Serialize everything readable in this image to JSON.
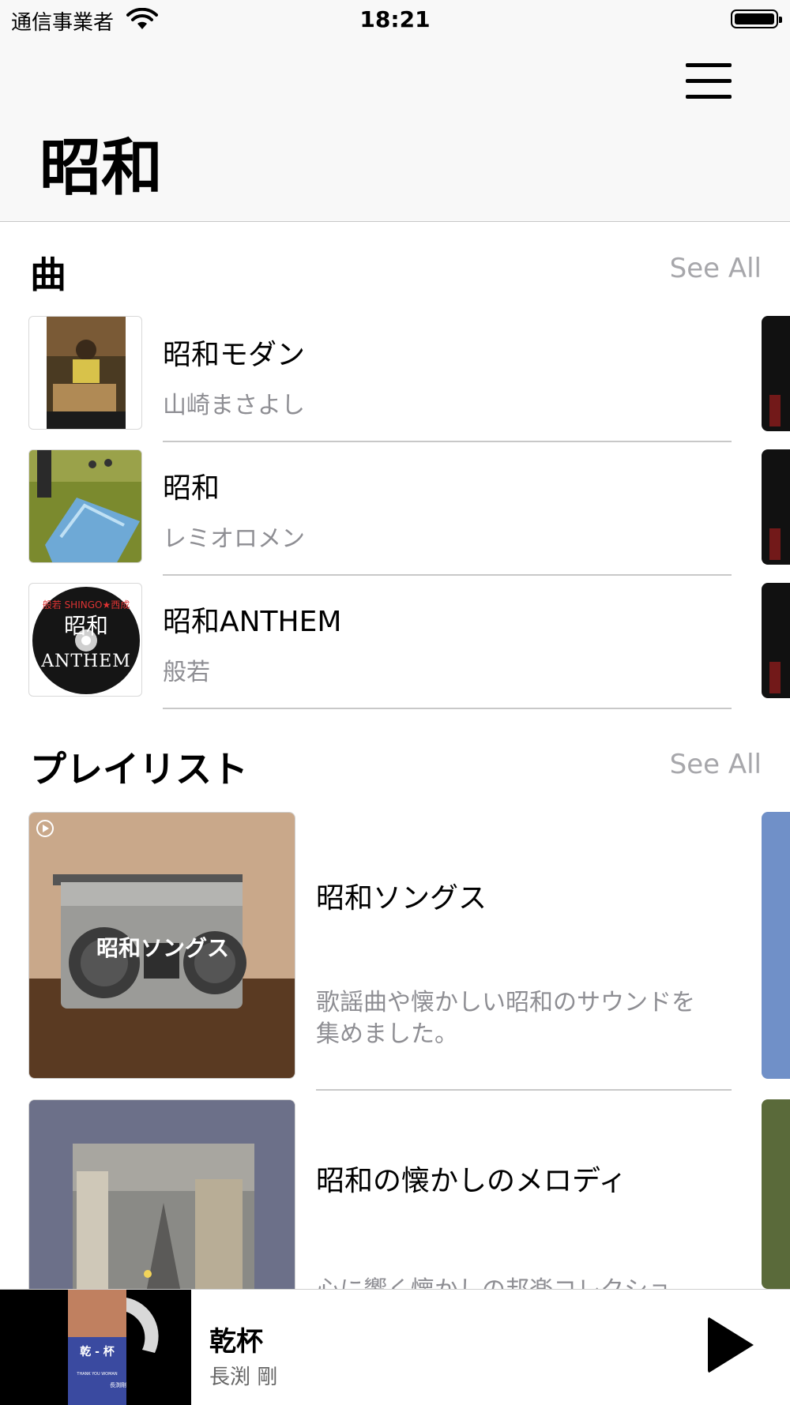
{
  "status_bar": {
    "carrier": "通信事業者",
    "time": "18:21"
  },
  "nav": {
    "title": "昭和"
  },
  "songs_section": {
    "title": "曲",
    "see_all": "See All",
    "items": [
      {
        "title": "昭和モダン",
        "artist": "山崎まさよし"
      },
      {
        "title": "昭和",
        "artist": "レミオロメン"
      },
      {
        "title": "昭和ANTHEM",
        "artist": "般若"
      }
    ],
    "disc_text": {
      "top": "般若 SHINGO★西成",
      "kanji": "昭和",
      "word": "ANTHEM"
    }
  },
  "playlists_section": {
    "title": "プレイリスト",
    "see_all": "See All",
    "items": [
      {
        "title": "昭和ソングス",
        "description": "歌謡曲や懐かしい昭和のサウンドを集めました。",
        "art_label": "昭和ソングス"
      },
      {
        "title": "昭和の懐かしのメロディ",
        "description": "心に響く懐かしの邦楽コレクショ"
      }
    ]
  },
  "mini_player": {
    "title": "乾杯",
    "artist": "長渕 剛",
    "art_text": {
      "kanji": "乾 - 杯",
      "sub": "THANK YOU WOMAN",
      "name": "長渕剛"
    }
  },
  "colors": {
    "secondary_text": "#8e8e93",
    "see_all": "#a7a7ab",
    "nav_bg": "#f8f8f8"
  },
  "icons": [
    "wifi-icon",
    "battery-icon",
    "menu-icon",
    "play-icon",
    "playlist-badge-icon"
  ]
}
